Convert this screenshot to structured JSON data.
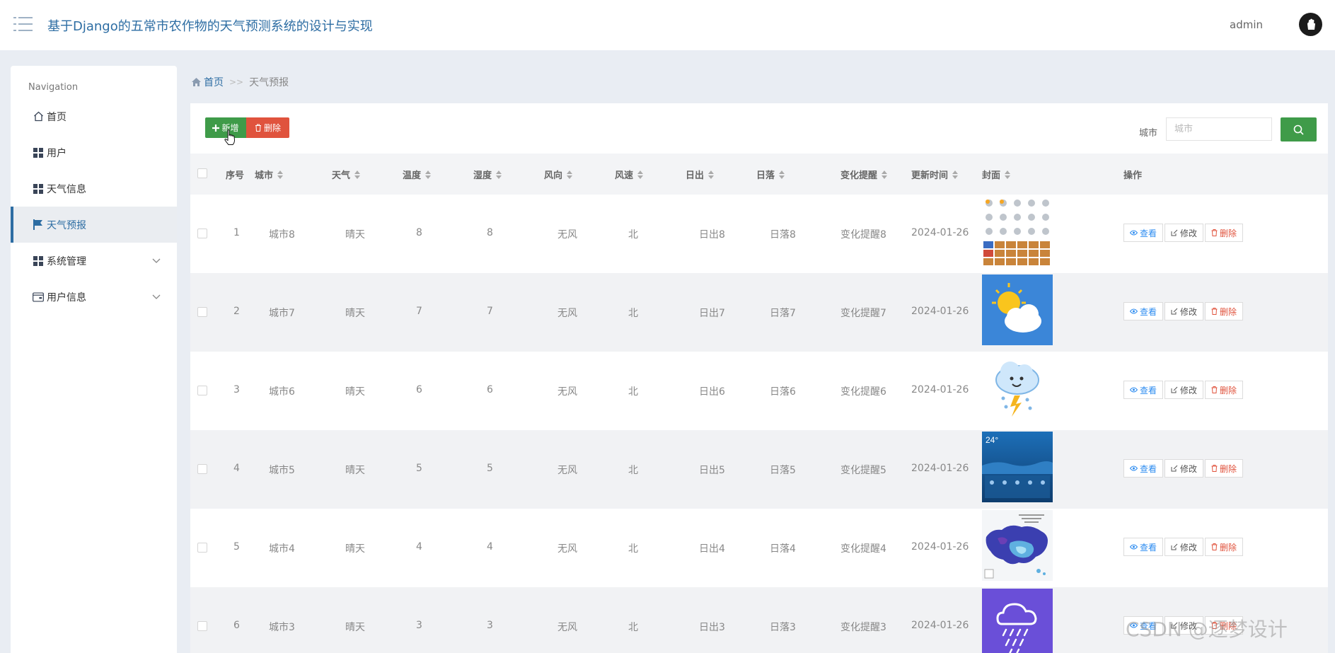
{
  "header": {
    "title": "基于Django的五常市农作物的天气预测系统的设计与实现",
    "user": "admin"
  },
  "sidebar": {
    "caption": "Navigation",
    "items": [
      {
        "label": "首页",
        "icon": "home-icon"
      },
      {
        "label": "用户",
        "icon": "grid-icon"
      },
      {
        "label": "天气信息",
        "icon": "grid-icon"
      },
      {
        "label": "天气预报",
        "icon": "flag-icon",
        "active": true
      },
      {
        "label": "系统管理",
        "icon": "grid-icon",
        "expandable": true
      },
      {
        "label": "用户信息",
        "icon": "wallet-icon",
        "expandable": true
      }
    ]
  },
  "breadcrumb": {
    "home": "首页",
    "separator": ">>",
    "current": "天气预报"
  },
  "toolbar": {
    "add_label": "新增",
    "delete_label": "删除",
    "search_label": "城市",
    "search_placeholder": "城市"
  },
  "table": {
    "columns": [
      "序号",
      "城市",
      "天气",
      "温度",
      "湿度",
      "风向",
      "风速",
      "日出",
      "日落",
      "变化提醒",
      "更新时间",
      "封面",
      "操作"
    ],
    "rows": [
      {
        "no": "1",
        "city": "城市8",
        "weather": "晴天",
        "temp": "8",
        "humidity": "8",
        "wind_dir": "无风",
        "wind_speed": "北",
        "sunrise": "日出8",
        "sunset": "日落8",
        "alert": "变化提醒8",
        "updated": "2024-01-26",
        "cover": "weather-icon-sheet"
      },
      {
        "no": "2",
        "city": "城市7",
        "weather": "晴天",
        "temp": "7",
        "humidity": "7",
        "wind_dir": "无风",
        "wind_speed": "北",
        "sunrise": "日出7",
        "sunset": "日落7",
        "alert": "变化提醒7",
        "updated": "2024-01-26",
        "cover": "sun-cloud-image"
      },
      {
        "no": "3",
        "city": "城市6",
        "weather": "晴天",
        "temp": "6",
        "humidity": "6",
        "wind_dir": "无风",
        "wind_speed": "北",
        "sunrise": "日出6",
        "sunset": "日落6",
        "alert": "变化提醒6",
        "updated": "2024-01-26",
        "cover": "storm-cloud-image"
      },
      {
        "no": "4",
        "city": "城市5",
        "weather": "晴天",
        "temp": "5",
        "humidity": "5",
        "wind_dir": "无风",
        "wind_speed": "北",
        "sunrise": "日出5",
        "sunset": "日落5",
        "alert": "变化提醒5",
        "updated": "2024-01-26",
        "cover": "weather-app-image",
        "cover_text": "24°"
      },
      {
        "no": "5",
        "city": "城市4",
        "weather": "晴天",
        "temp": "4",
        "humidity": "4",
        "wind_dir": "无风",
        "wind_speed": "北",
        "sunrise": "日出4",
        "sunset": "日落4",
        "alert": "变化提醒4",
        "updated": "2024-01-26",
        "cover": "temperature-map-image"
      },
      {
        "no": "6",
        "city": "城市3",
        "weather": "晴天",
        "temp": "3",
        "humidity": "3",
        "wind_dir": "无风",
        "wind_speed": "北",
        "sunrise": "日出3",
        "sunset": "日落3",
        "alert": "变化提醒3",
        "updated": "2024-01-26",
        "cover": "rain-cloud-image"
      }
    ],
    "actions": {
      "view": "查看",
      "edit": "修改",
      "delete": "删除"
    }
  },
  "watermark": "CSDN @逐梦设计",
  "colors": {
    "primary": "#2d6da3",
    "success": "#3f9b49",
    "danger": "#e0533d",
    "background": "#e9edf3"
  }
}
